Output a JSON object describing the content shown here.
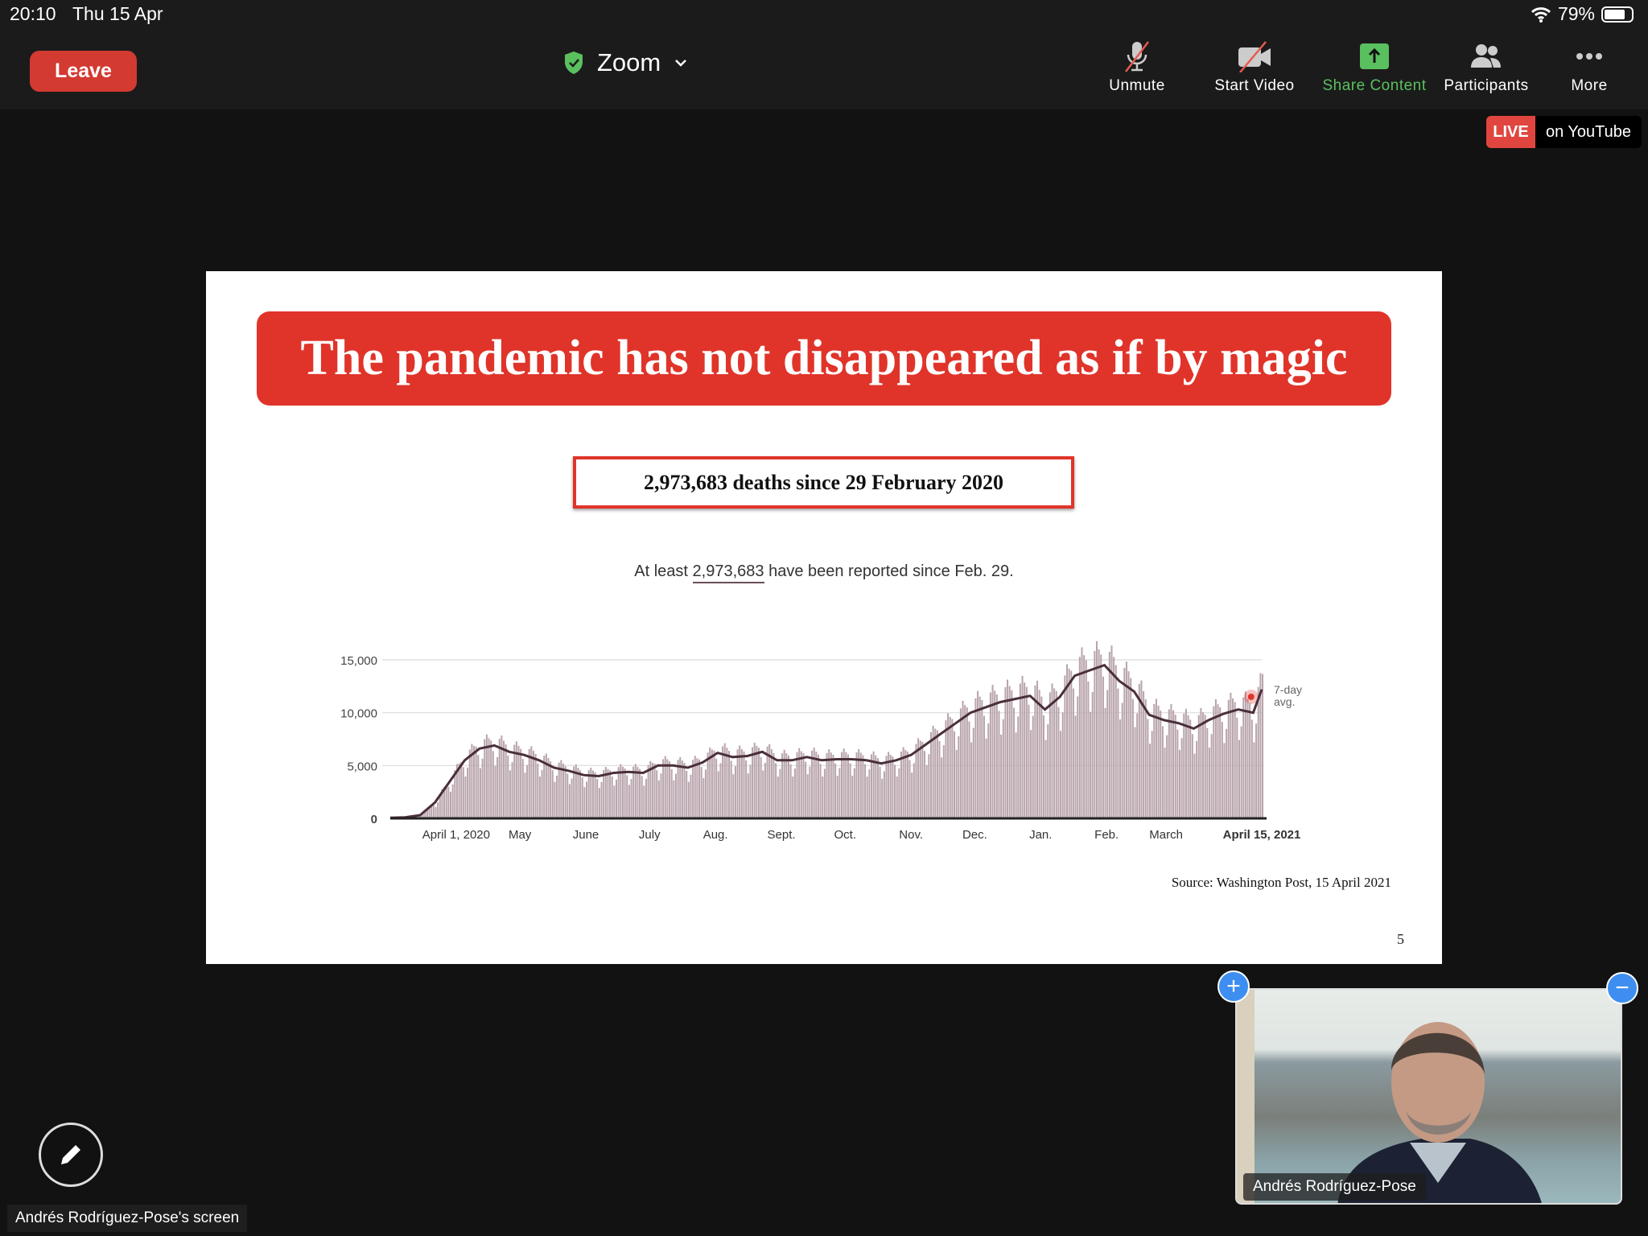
{
  "status_bar": {
    "time": "20:10",
    "date": "Thu 15 Apr",
    "battery": "79%",
    "battery_level": 0.79
  },
  "header": {
    "leave_label": "Leave",
    "title": "Zoom",
    "tools": [
      {
        "label": "Unmute",
        "icon": "microphone-muted-icon"
      },
      {
        "label": "Start Video",
        "icon": "video-off-icon"
      },
      {
        "label": "Share Content",
        "icon": "share-up-arrow-icon",
        "color": "#5ac05f"
      },
      {
        "label": "Participants",
        "icon": "participants-icon"
      },
      {
        "label": "More",
        "icon": "more-dots-icon"
      }
    ]
  },
  "live_badge": {
    "live": "LIVE",
    "platform": "on YouTube"
  },
  "slide": {
    "title": "The pandemic has not disappeared as if by magic",
    "deaths_box": "2,973,683 deaths since 29 February 2020",
    "subtitle_pre": "At least ",
    "subtitle_num": "2,973,683",
    "subtitle_post": " have been reported since Feb. 29.",
    "source": "Source: Washington Post, 15 April 2021",
    "page_number": "5"
  },
  "chart_data": {
    "type": "bar",
    "ylim": [
      0,
      15000
    ],
    "y_ticks": [
      "0",
      "5,000",
      "10,000",
      "15,000"
    ],
    "y_tick_values": [
      0,
      5000,
      10000,
      15000
    ],
    "x_ticks": [
      "April 1, 2020",
      "May",
      "June",
      "July",
      "Aug.",
      "Sept.",
      "Oct.",
      "Nov.",
      "Dec.",
      "Jan.",
      "Feb.",
      "March",
      "April 15, 2021"
    ],
    "x_tick_dates": [
      "2020-04-01",
      "2020-05-01",
      "2020-06-01",
      "2020-07-01",
      "2020-08-01",
      "2020-09-01",
      "2020-10-01",
      "2020-11-01",
      "2020-12-01",
      "2021-01-01",
      "2021-02-01",
      "2021-03-01",
      "2021-04-15"
    ],
    "x_range": [
      "2020-03-01",
      "2021-04-15"
    ],
    "avg_label": "7-day avg.",
    "bar_color": "#b9a5ad",
    "line_color": "#4a2f3b",
    "highlight_color": "#e0342a",
    "grid": true,
    "seven_day_avg": {
      "dates": [
        "2020-03-01",
        "2020-03-08",
        "2020-03-15",
        "2020-03-22",
        "2020-03-29",
        "2020-04-05",
        "2020-04-12",
        "2020-04-19",
        "2020-04-26",
        "2020-05-03",
        "2020-05-10",
        "2020-05-17",
        "2020-05-24",
        "2020-05-31",
        "2020-06-07",
        "2020-06-14",
        "2020-06-21",
        "2020-06-28",
        "2020-07-05",
        "2020-07-12",
        "2020-07-19",
        "2020-07-26",
        "2020-08-02",
        "2020-08-09",
        "2020-08-16",
        "2020-08-23",
        "2020-08-30",
        "2020-09-06",
        "2020-09-13",
        "2020-09-20",
        "2020-09-27",
        "2020-10-04",
        "2020-10-11",
        "2020-10-18",
        "2020-10-25",
        "2020-11-01",
        "2020-11-08",
        "2020-11-15",
        "2020-11-22",
        "2020-11-29",
        "2020-12-06",
        "2020-12-13",
        "2020-12-20",
        "2020-12-27",
        "2021-01-03",
        "2021-01-10",
        "2021-01-17",
        "2021-01-24",
        "2021-01-31",
        "2021-02-07",
        "2021-02-14",
        "2021-02-21",
        "2021-02-28",
        "2021-03-07",
        "2021-03-14",
        "2021-03-21",
        "2021-03-28",
        "2021-04-04",
        "2021-04-11",
        "2021-04-15"
      ],
      "values": [
        50,
        100,
        300,
        1500,
        3500,
        5500,
        6600,
        6900,
        6300,
        6000,
        5500,
        4800,
        4500,
        4100,
        4000,
        4300,
        4400,
        4300,
        5000,
        5000,
        4800,
        5300,
        6200,
        5800,
        5900,
        6300,
        5500,
        5500,
        5800,
        5500,
        5600,
        5600,
        5500,
        5200,
        5500,
        6000,
        7000,
        8000,
        9000,
        10000,
        10500,
        11000,
        11300,
        11600,
        10300,
        11500,
        13500,
        14000,
        14500,
        13000,
        12000,
        9800,
        9300,
        9000,
        8500,
        9300,
        9900,
        10300,
        10000,
        12200
      ]
    },
    "highlight": {
      "date": "2021-04-10",
      "value": 11500
    }
  },
  "bottom": {
    "screen_label": "Andrés Rodríguez-Pose's screen",
    "video_name": "Andrés Rodríguez-Pose"
  }
}
